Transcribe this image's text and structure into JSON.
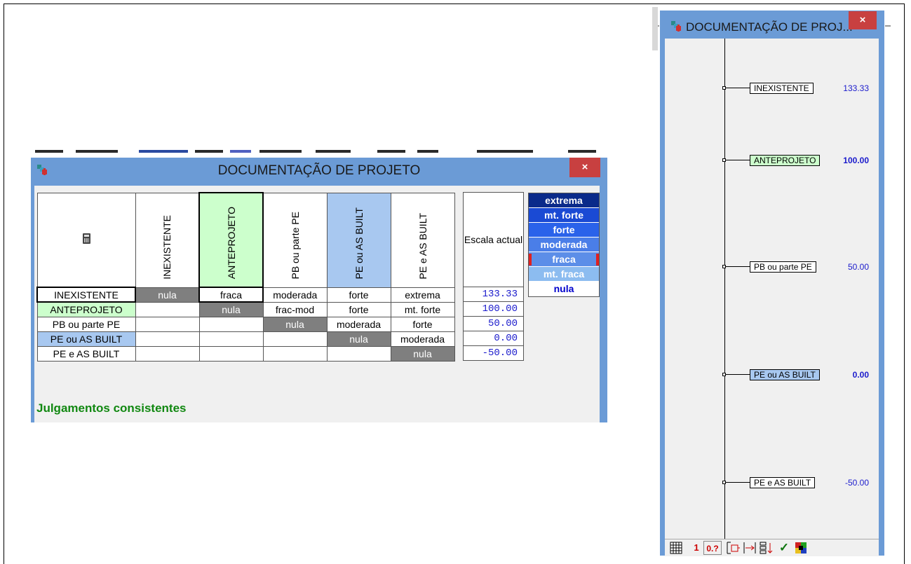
{
  "left_window": {
    "title": "DOCUMENTAÇÃO DE PROJETO",
    "close_label": "×",
    "columns": [
      "INEXISTENTE",
      "ANTEPROJETO",
      "PB ou parte PE",
      "PE ou AS BUILT",
      "PE  e AS BUILT"
    ],
    "rows": [
      {
        "label": "INEXISTENTE",
        "cells": [
          "nula",
          "fraca",
          "moderada",
          "forte",
          "extrema"
        ]
      },
      {
        "label": "ANTEPROJETO",
        "cells": [
          "",
          "nula",
          "frac-mod",
          "forte",
          "mt. forte"
        ]
      },
      {
        "label": "PB ou parte PE",
        "cells": [
          "",
          "",
          "nula",
          "moderada",
          "forte"
        ]
      },
      {
        "label": "PE ou AS BUILT",
        "cells": [
          "",
          "",
          "",
          "nula",
          "moderada"
        ]
      },
      {
        "label": "PE  e AS BUILT",
        "cells": [
          "",
          "",
          "",
          "",
          "nula"
        ]
      }
    ],
    "scale_header": "Escala actual",
    "scale_values": [
      "133.33",
      "100.00",
      "50.00",
      "0.00",
      "-50.00"
    ],
    "legend": [
      "extrema",
      "mt. forte",
      "forte",
      "moderada",
      "fraca",
      "mt. fraca",
      "nula"
    ],
    "legend_colors": [
      "#0a2a8a",
      "#1a4ad4",
      "#2a62ea",
      "#4a7ee8",
      "#5c8ee8",
      "#8cbcf0",
      "#ffffff"
    ],
    "status": "Julgamentos consistentes"
  },
  "right_window": {
    "title": "DOCUMENTAÇÃO DE PROJ...",
    "close_label": "×",
    "scale": [
      {
        "label": "INEXISTENTE",
        "value": "133.33"
      },
      {
        "label": "ANTEPROJETO",
        "value": "100.00"
      },
      {
        "label": "PB ou parte PE",
        "value": "50.00"
      },
      {
        "label": "PE ou AS BUILT",
        "value": "0.00"
      },
      {
        "label": "PE  e AS BUILT",
        "value": "-50.00"
      }
    ],
    "toolbar": {
      "one": "1",
      "zero_q": "0.?",
      "check": "✓"
    }
  },
  "colors": {
    "title_bar": "#6b9bd6",
    "close": "#c84040",
    "green_highlight": "#ccffcc",
    "blue_highlight": "#a8c8f0",
    "status_green": "#118811"
  }
}
